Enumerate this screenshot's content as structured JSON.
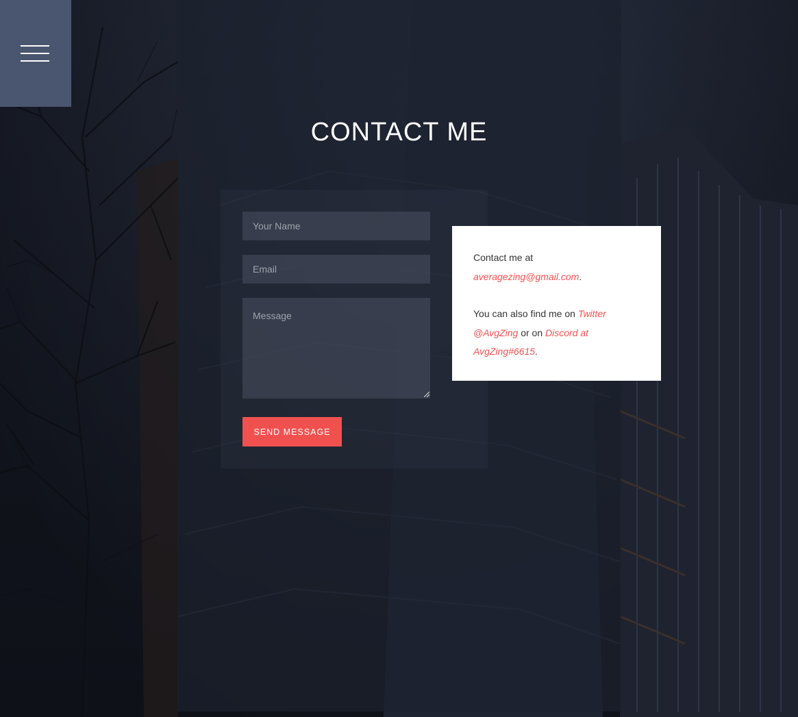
{
  "menu": {
    "icon": "hamburger-menu-icon"
  },
  "header": {
    "title": "CONTACT ME"
  },
  "form": {
    "name_placeholder": "Your Name",
    "email_placeholder": "Email",
    "message_placeholder": "Message",
    "submit_label": "SEND MESSAGE"
  },
  "info": {
    "line1_prefix": "Contact me at",
    "email": "averagezing@gmail.com",
    "line1_suffix": ".",
    "line2_prefix": "You can also find me on",
    "twitter": "Twitter @AvgZing",
    "line2_mid": "or on",
    "discord": "Discord at AvgZing#6615",
    "line2_suffix": "."
  },
  "colors": {
    "accent": "#f0514f",
    "menu_bg": "#4a5670",
    "panel_bg": "#1c212e",
    "card_bg": "#ffffff"
  }
}
